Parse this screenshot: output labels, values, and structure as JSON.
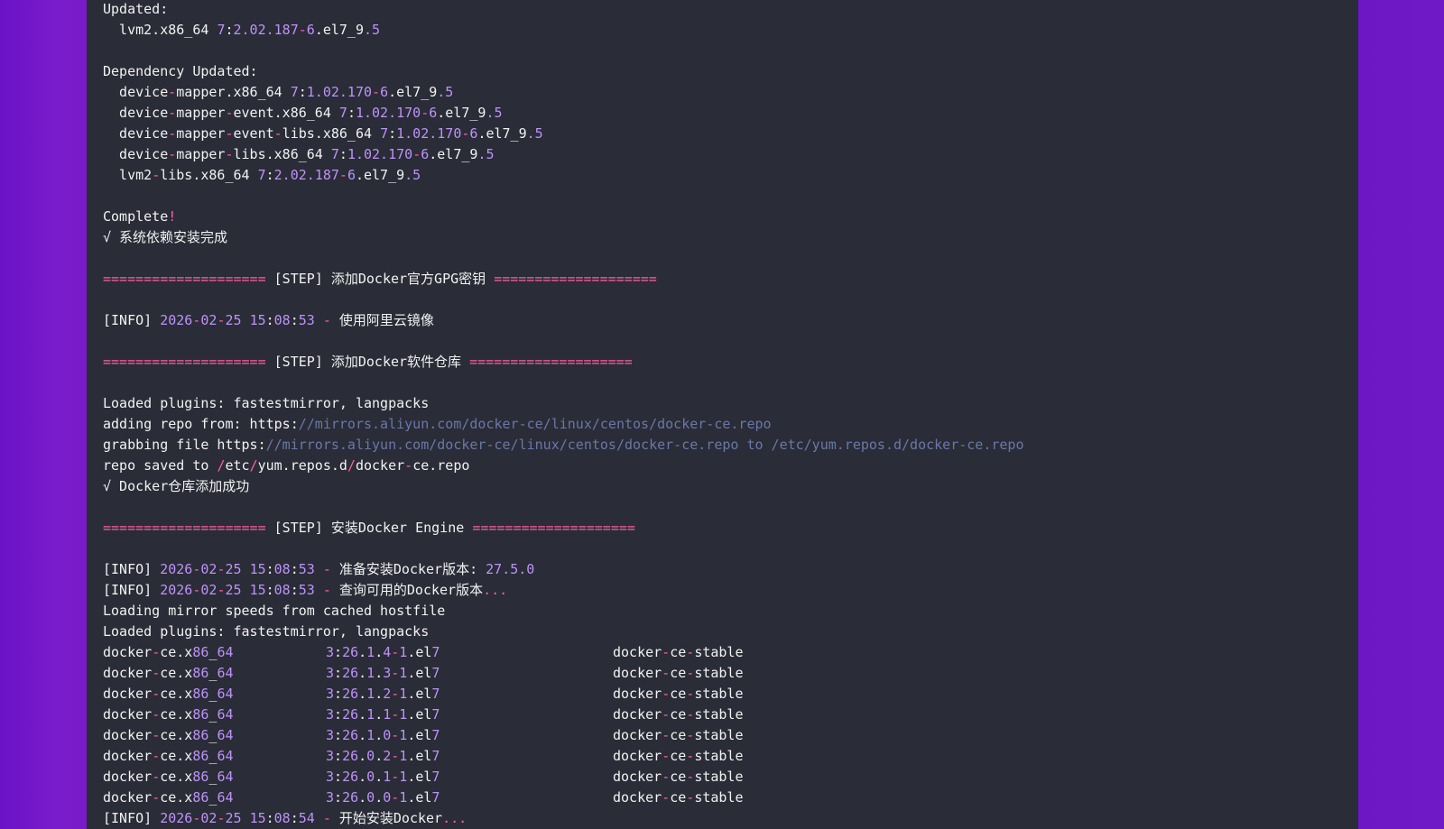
{
  "terminal": {
    "lines": [
      [
        {
          "t": "t",
          "v": "Updated:"
        }
      ],
      [
        {
          "t": "t",
          "v": "  lvm2.x86_64 "
        },
        {
          "t": "n",
          "v": "7"
        },
        {
          "t": "t",
          "v": ":"
        },
        {
          "t": "n",
          "v": "2.02.187"
        },
        {
          "t": "p",
          "v": "-"
        },
        {
          "t": "n",
          "v": "6"
        },
        {
          "t": "t",
          "v": ".el7_9"
        },
        {
          "t": "n",
          "v": ".5"
        }
      ],
      [],
      [
        {
          "t": "t",
          "v": "Dependency Updated:"
        }
      ],
      [
        {
          "t": "t",
          "v": "  device"
        },
        {
          "t": "p",
          "v": "-"
        },
        {
          "t": "t",
          "v": "mapper.x86_64 "
        },
        {
          "t": "n",
          "v": "7"
        },
        {
          "t": "t",
          "v": ":"
        },
        {
          "t": "n",
          "v": "1.02.170"
        },
        {
          "t": "p",
          "v": "-"
        },
        {
          "t": "n",
          "v": "6"
        },
        {
          "t": "t",
          "v": ".el7_9"
        },
        {
          "t": "n",
          "v": ".5"
        }
      ],
      [
        {
          "t": "t",
          "v": "  device"
        },
        {
          "t": "p",
          "v": "-"
        },
        {
          "t": "t",
          "v": "mapper"
        },
        {
          "t": "p",
          "v": "-"
        },
        {
          "t": "t",
          "v": "event.x86_64 "
        },
        {
          "t": "n",
          "v": "7"
        },
        {
          "t": "t",
          "v": ":"
        },
        {
          "t": "n",
          "v": "1.02.170"
        },
        {
          "t": "p",
          "v": "-"
        },
        {
          "t": "n",
          "v": "6"
        },
        {
          "t": "t",
          "v": ".el7_9"
        },
        {
          "t": "n",
          "v": ".5"
        }
      ],
      [
        {
          "t": "t",
          "v": "  device"
        },
        {
          "t": "p",
          "v": "-"
        },
        {
          "t": "t",
          "v": "mapper"
        },
        {
          "t": "p",
          "v": "-"
        },
        {
          "t": "t",
          "v": "event"
        },
        {
          "t": "p",
          "v": "-"
        },
        {
          "t": "t",
          "v": "libs.x86_64 "
        },
        {
          "t": "n",
          "v": "7"
        },
        {
          "t": "t",
          "v": ":"
        },
        {
          "t": "n",
          "v": "1.02.170"
        },
        {
          "t": "p",
          "v": "-"
        },
        {
          "t": "n",
          "v": "6"
        },
        {
          "t": "t",
          "v": ".el7_9"
        },
        {
          "t": "n",
          "v": ".5"
        }
      ],
      [
        {
          "t": "t",
          "v": "  device"
        },
        {
          "t": "p",
          "v": "-"
        },
        {
          "t": "t",
          "v": "mapper"
        },
        {
          "t": "p",
          "v": "-"
        },
        {
          "t": "t",
          "v": "libs.x86_64 "
        },
        {
          "t": "n",
          "v": "7"
        },
        {
          "t": "t",
          "v": ":"
        },
        {
          "t": "n",
          "v": "1.02.170"
        },
        {
          "t": "p",
          "v": "-"
        },
        {
          "t": "n",
          "v": "6"
        },
        {
          "t": "t",
          "v": ".el7_9"
        },
        {
          "t": "n",
          "v": ".5"
        }
      ],
      [
        {
          "t": "t",
          "v": "  lvm2"
        },
        {
          "t": "p",
          "v": "-"
        },
        {
          "t": "t",
          "v": "libs.x86_64 "
        },
        {
          "t": "n",
          "v": "7"
        },
        {
          "t": "t",
          "v": ":"
        },
        {
          "t": "n",
          "v": "2.02.187"
        },
        {
          "t": "p",
          "v": "-"
        },
        {
          "t": "n",
          "v": "6"
        },
        {
          "t": "t",
          "v": ".el7_9"
        },
        {
          "t": "n",
          "v": ".5"
        }
      ],
      [],
      [
        {
          "t": "t",
          "v": "Complete"
        },
        {
          "t": "p",
          "v": "!"
        }
      ],
      [
        {
          "t": "t",
          "v": "√ 系统依赖安装完成"
        }
      ],
      [],
      [
        {
          "t": "p",
          "v": "===================="
        },
        {
          "t": "t",
          "v": " [STEP] 添加Docker官方GPG密钥 "
        },
        {
          "t": "p",
          "v": "===================="
        }
      ],
      [],
      [
        {
          "t": "t",
          "v": "[INFO] "
        },
        {
          "t": "n",
          "v": "2026"
        },
        {
          "t": "p",
          "v": "-"
        },
        {
          "t": "n",
          "v": "02"
        },
        {
          "t": "p",
          "v": "-"
        },
        {
          "t": "n",
          "v": "25"
        },
        {
          "t": "t",
          "v": " "
        },
        {
          "t": "n",
          "v": "15"
        },
        {
          "t": "t",
          "v": ":"
        },
        {
          "t": "n",
          "v": "08"
        },
        {
          "t": "t",
          "v": ":"
        },
        {
          "t": "n",
          "v": "53"
        },
        {
          "t": "t",
          "v": " "
        },
        {
          "t": "p",
          "v": "-"
        },
        {
          "t": "t",
          "v": " 使用阿里云镜像"
        }
      ],
      [],
      [
        {
          "t": "p",
          "v": "===================="
        },
        {
          "t": "t",
          "v": " [STEP] 添加Docker软件仓库 "
        },
        {
          "t": "p",
          "v": "===================="
        }
      ],
      [],
      [
        {
          "t": "t",
          "v": "Loaded plugins: fastestmirror, langpacks"
        }
      ],
      [
        {
          "t": "t",
          "v": "adding repo from: https:"
        },
        {
          "t": "g",
          "v": "//mirrors.aliyun.com/docker-ce/linux/centos/docker-ce.repo"
        }
      ],
      [
        {
          "t": "t",
          "v": "grabbing file https:"
        },
        {
          "t": "g",
          "v": "//mirrors.aliyun.com/docker-ce/linux/centos/docker-ce.repo to /etc/yum.repos.d/docker-ce.repo"
        }
      ],
      [
        {
          "t": "t",
          "v": "repo saved to "
        },
        {
          "t": "p",
          "v": "/"
        },
        {
          "t": "t",
          "v": "etc"
        },
        {
          "t": "p",
          "v": "/"
        },
        {
          "t": "t",
          "v": "yum.repos.d"
        },
        {
          "t": "p",
          "v": "/"
        },
        {
          "t": "t",
          "v": "docker"
        },
        {
          "t": "p",
          "v": "-"
        },
        {
          "t": "t",
          "v": "ce.repo"
        }
      ],
      [
        {
          "t": "t",
          "v": "√ Docker仓库添加成功"
        }
      ],
      [],
      [
        {
          "t": "p",
          "v": "===================="
        },
        {
          "t": "t",
          "v": " [STEP] 安装Docker Engine "
        },
        {
          "t": "p",
          "v": "===================="
        }
      ],
      [],
      [
        {
          "t": "t",
          "v": "[INFO] "
        },
        {
          "t": "n",
          "v": "2026"
        },
        {
          "t": "p",
          "v": "-"
        },
        {
          "t": "n",
          "v": "02"
        },
        {
          "t": "p",
          "v": "-"
        },
        {
          "t": "n",
          "v": "25"
        },
        {
          "t": "t",
          "v": " "
        },
        {
          "t": "n",
          "v": "15"
        },
        {
          "t": "t",
          "v": ":"
        },
        {
          "t": "n",
          "v": "08"
        },
        {
          "t": "t",
          "v": ":"
        },
        {
          "t": "n",
          "v": "53"
        },
        {
          "t": "t",
          "v": " "
        },
        {
          "t": "p",
          "v": "-"
        },
        {
          "t": "t",
          "v": " 准备安装Docker版本: "
        },
        {
          "t": "n",
          "v": "27.5.0"
        }
      ],
      [
        {
          "t": "t",
          "v": "[INFO] "
        },
        {
          "t": "n",
          "v": "2026"
        },
        {
          "t": "p",
          "v": "-"
        },
        {
          "t": "n",
          "v": "02"
        },
        {
          "t": "p",
          "v": "-"
        },
        {
          "t": "n",
          "v": "25"
        },
        {
          "t": "t",
          "v": " "
        },
        {
          "t": "n",
          "v": "15"
        },
        {
          "t": "t",
          "v": ":"
        },
        {
          "t": "n",
          "v": "08"
        },
        {
          "t": "t",
          "v": ":"
        },
        {
          "t": "n",
          "v": "53"
        },
        {
          "t": "t",
          "v": " "
        },
        {
          "t": "p",
          "v": "-"
        },
        {
          "t": "t",
          "v": " 查询可用的Docker版本"
        },
        {
          "t": "p",
          "v": "..."
        }
      ],
      [
        {
          "t": "t",
          "v": "Loading mirror speeds from cached hostfile"
        }
      ],
      [
        {
          "t": "t",
          "v": "Loaded plugins: fastestmirror, langpacks"
        }
      ]
    ],
    "packages": [
      {
        "name": "docker-ce.x86_64",
        "version": "3:26.1.4-1.el7",
        "repo": "docker-ce-stable"
      },
      {
        "name": "docker-ce.x86_64",
        "version": "3:26.1.3-1.el7",
        "repo": "docker-ce-stable"
      },
      {
        "name": "docker-ce.x86_64",
        "version": "3:26.1.2-1.el7",
        "repo": "docker-ce-stable"
      },
      {
        "name": "docker-ce.x86_64",
        "version": "3:26.1.1-1.el7",
        "repo": "docker-ce-stable"
      },
      {
        "name": "docker-ce.x86_64",
        "version": "3:26.1.0-1.el7",
        "repo": "docker-ce-stable"
      },
      {
        "name": "docker-ce.x86_64",
        "version": "3:26.0.2-1.el7",
        "repo": "docker-ce-stable"
      },
      {
        "name": "docker-ce.x86_64",
        "version": "3:26.0.1-1.el7",
        "repo": "docker-ce-stable"
      },
      {
        "name": "docker-ce.x86_64",
        "version": "3:26.0.0-1.el7",
        "repo": "docker-ce-stable"
      }
    ],
    "tail": [
      [
        {
          "t": "t",
          "v": "[INFO] "
        },
        {
          "t": "n",
          "v": "2026"
        },
        {
          "t": "p",
          "v": "-"
        },
        {
          "t": "n",
          "v": "02"
        },
        {
          "t": "p",
          "v": "-"
        },
        {
          "t": "n",
          "v": "25"
        },
        {
          "t": "t",
          "v": " "
        },
        {
          "t": "n",
          "v": "15"
        },
        {
          "t": "t",
          "v": ":"
        },
        {
          "t": "n",
          "v": "08"
        },
        {
          "t": "t",
          "v": ":"
        },
        {
          "t": "n",
          "v": "54"
        },
        {
          "t": "t",
          "v": " "
        },
        {
          "t": "p",
          "v": "-"
        },
        {
          "t": "t",
          "v": " 开始安装Docker"
        },
        {
          "t": "p",
          "v": "..."
        }
      ]
    ]
  },
  "colors": {
    "background": "#2a2c37",
    "text": "#f2f2f2",
    "number": "#bd93f9",
    "punct": "#ff5fa8",
    "url": "#6a78a8",
    "desktop": "#6a12c8"
  }
}
